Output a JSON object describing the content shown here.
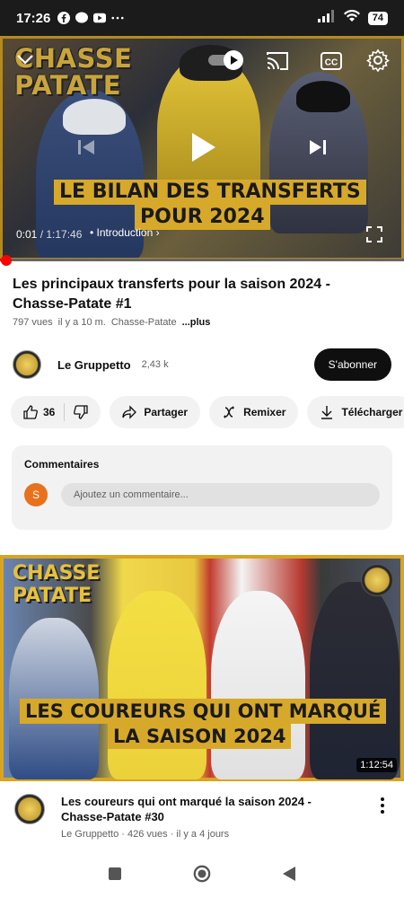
{
  "status_bar": {
    "time": "17:26",
    "battery": "74",
    "icons": [
      "facebook-icon",
      "messenger-icon",
      "youtube-icon",
      "more-dots-icon",
      "signal-icon",
      "wifi-icon"
    ]
  },
  "player": {
    "current_time": "0:01",
    "duration": "/ 1:17:46",
    "chapter": "• Introduction",
    "progress_fraction": 0.0002,
    "overlay_logo_line1": "CHASSE",
    "overlay_logo_line2": "PATATE",
    "banner_line1": "LE BILAN DES TRANSFERTS",
    "banner_line2": "POUR 2024"
  },
  "video": {
    "title": "Les principaux transferts pour la saison 2024 - Chasse-Patate #1",
    "views": "797 vues",
    "age": "il y a 10 m.",
    "channel_tag": "Chasse-Patate",
    "more": "...plus"
  },
  "channel": {
    "name": "Le Gruppetto",
    "subscribers": "2,43 k",
    "subscribe_label": "S'abonner"
  },
  "actions": {
    "likes": "36",
    "share": "Partager",
    "remix": "Remixer",
    "download": "Télécharger"
  },
  "comments": {
    "header": "Commentaires",
    "avatar_letter": "S",
    "placeholder": "Ajoutez un commentaire..."
  },
  "next_video": {
    "logo_line1": "CHASSE",
    "logo_line2": "PATATE",
    "banner_line1": "LES COUREURS QUI ONT MARQUÉ",
    "banner_line2": "LA SAISON 2024",
    "duration": "1:12:54",
    "title": "Les coureurs qui ont marqué la saison 2024 - Chasse-Patate #30",
    "meta": "Le Gruppetto · 426 vues · il y a 4 jours"
  },
  "colors": {
    "accent_gold": "#d7a92a",
    "progress_red": "#ff0000",
    "subscribe_bg": "#0f0f0f"
  }
}
